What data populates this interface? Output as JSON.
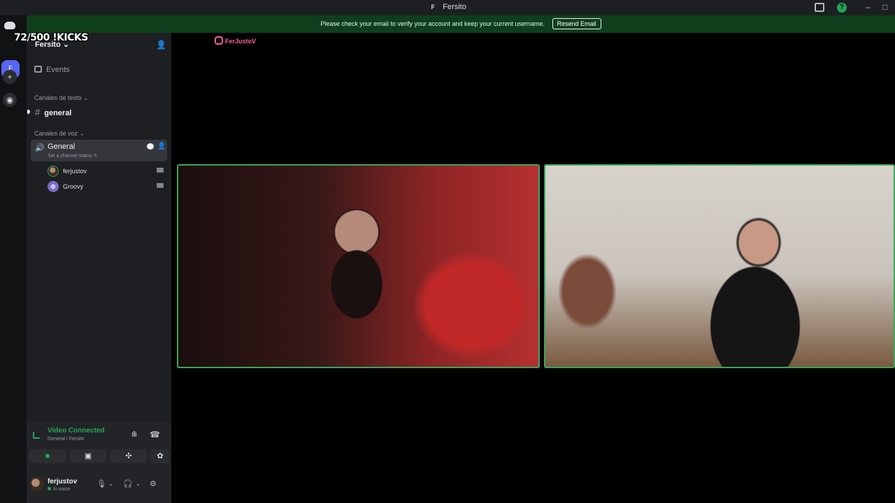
{
  "window": {
    "title": "Fersito",
    "title_icon": "F"
  },
  "banner": {
    "message": "Please check your email to verify your account and keep your current username.",
    "button": "Resend Email"
  },
  "overlay": {
    "kicks": "72/500 !KICKS"
  },
  "server": {
    "name": "Fersito",
    "initial": "F"
  },
  "sidebar": {
    "events": "Events",
    "text_category": "Canales de texto",
    "text_channel": "general",
    "voice_category": "Canales de voz",
    "voice_channel": {
      "name": "General",
      "status": "Set a channel status"
    },
    "members": [
      {
        "name": "ferjustov",
        "avatar_color": "#7a5a48"
      },
      {
        "name": "Groovy",
        "avatar_color": "#7b6cc8"
      }
    ]
  },
  "voice_panel": {
    "status": "Video Connected",
    "location": "General / Fersito"
  },
  "user": {
    "name": "ferjustov",
    "status": "In voice"
  },
  "stage": {
    "instagram_handle": "FerJustoV"
  },
  "colors": {
    "accent_green": "#23a55a",
    "banner_green": "#0f3e1c",
    "blurple": "#5865f2",
    "ig_pink": "#ff5ea8"
  }
}
